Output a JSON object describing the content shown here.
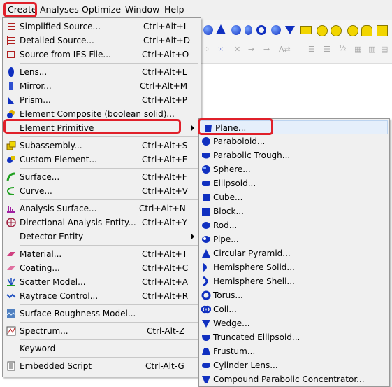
{
  "menubar": {
    "items": [
      {
        "label": "Create",
        "underline": "C"
      },
      {
        "label": "Analyses",
        "underline": "A"
      },
      {
        "label": "Optimize",
        "underline": "O"
      },
      {
        "label": "Window",
        "underline": "W"
      },
      {
        "label": "Help",
        "underline": "H"
      }
    ]
  },
  "create_menu": {
    "items": [
      {
        "label": "Simplified Source...",
        "shortcut": "Ctrl+Alt+I",
        "icon": "simplified-source-icon"
      },
      {
        "label": "Detailed Source...",
        "shortcut": "Ctrl+Alt+D",
        "icon": "detailed-source-icon"
      },
      {
        "label": "Source from IES File...",
        "shortcut": "Ctrl+Alt+O",
        "icon": "ies-source-icon"
      },
      {
        "label": "Lens...",
        "shortcut": "Ctrl+Alt+L",
        "icon": "lens-icon"
      },
      {
        "label": "Mirror...",
        "shortcut": "Ctrl+Alt+M",
        "icon": "mirror-icon"
      },
      {
        "label": "Prism...",
        "shortcut": "Ctrl+Alt+P",
        "icon": "prism-icon"
      },
      {
        "label": "Element Composite (boolean solid)...",
        "shortcut": "",
        "icon": "element-composite-icon"
      },
      {
        "label": "Element Primitive",
        "shortcut": "",
        "icon": ""
      },
      {
        "label": "Subassembly...",
        "shortcut": "Ctrl+Alt+S",
        "icon": "subassembly-icon"
      },
      {
        "label": "Custom Element...",
        "shortcut": "Ctrl+Alt+E",
        "icon": "custom-element-icon"
      },
      {
        "label": "Surface...",
        "shortcut": "Ctrl+Alt+F",
        "icon": "surface-icon"
      },
      {
        "label": "Curve...",
        "shortcut": "Ctrl+Alt+V",
        "icon": "curve-icon"
      },
      {
        "label": "Analysis Surface...",
        "shortcut": "Ctrl+Alt+N",
        "icon": "analysis-surface-icon"
      },
      {
        "label": "Directional Analysis Entity...",
        "shortcut": "Ctrl+Alt+Y",
        "icon": "directional-analysis-icon"
      },
      {
        "label": "Detector Entity",
        "shortcut": "",
        "icon": ""
      },
      {
        "label": "Material...",
        "shortcut": "Ctrl+Alt+T",
        "icon": "material-icon"
      },
      {
        "label": "Coating...",
        "shortcut": "Ctrl+Alt+C",
        "icon": "coating-icon"
      },
      {
        "label": "Scatter Model...",
        "shortcut": "Ctrl+Alt+A",
        "icon": "scatter-model-icon"
      },
      {
        "label": "Raytrace Control...",
        "shortcut": "Ctrl+Alt+R",
        "icon": "raytrace-control-icon"
      },
      {
        "label": "Surface Roughness Model...",
        "shortcut": "",
        "icon": "surface-roughness-icon"
      },
      {
        "label": "Spectrum...",
        "shortcut": "Ctrl-Alt-Z",
        "icon": "spectrum-icon"
      },
      {
        "label": "Keyword",
        "shortcut": "",
        "icon": ""
      },
      {
        "label": "Embedded Script",
        "shortcut": "Ctrl-Alt-G",
        "icon": "embedded-script-icon"
      }
    ]
  },
  "primitive_menu": {
    "items": [
      {
        "label": "Plane...",
        "icon": "plane-icon"
      },
      {
        "label": "Paraboloid...",
        "icon": "paraboloid-icon"
      },
      {
        "label": "Parabolic Trough...",
        "icon": "parabolic-trough-icon"
      },
      {
        "label": "Sphere...",
        "icon": "sphere-icon"
      },
      {
        "label": "Ellipsoid...",
        "icon": "ellipsoid-icon"
      },
      {
        "label": "Cube...",
        "icon": "cube-icon"
      },
      {
        "label": "Block...",
        "icon": "block-icon"
      },
      {
        "label": "Rod...",
        "icon": "rod-icon"
      },
      {
        "label": "Pipe...",
        "icon": "pipe-icon"
      },
      {
        "label": "Circular Pyramid...",
        "icon": "circular-pyramid-icon"
      },
      {
        "label": "Hemisphere Solid...",
        "icon": "hemisphere-solid-icon"
      },
      {
        "label": "Hemisphere Shell...",
        "icon": "hemisphere-shell-icon"
      },
      {
        "label": "Torus...",
        "icon": "torus-icon"
      },
      {
        "label": "Coil...",
        "icon": "coil-icon"
      },
      {
        "label": "Wedge...",
        "icon": "wedge-icon"
      },
      {
        "label": "Truncated Ellipsoid...",
        "icon": "truncated-ellipsoid-icon"
      },
      {
        "label": "Frustum...",
        "icon": "frustum-icon"
      },
      {
        "label": "Cylinder Lens...",
        "icon": "cylinder-lens-icon"
      },
      {
        "label": "Compound Parabolic Concentrator...",
        "icon": "cpc-icon"
      }
    ]
  },
  "colors": {
    "highlight_box": "#e0202a",
    "menu_bg": "#f0f0f0",
    "icon_blue": "#1030c0"
  }
}
